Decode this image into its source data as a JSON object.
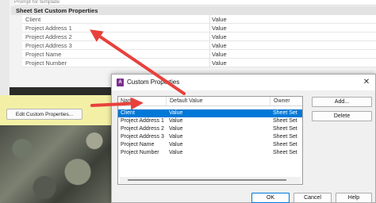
{
  "background_panel": {
    "top_row_text": "Prompt for template",
    "section_title": "Sheet Set Custom Properties",
    "rows": [
      {
        "name": "Client",
        "value": "Value"
      },
      {
        "name": "Project Address 1",
        "value": "Value"
      },
      {
        "name": "Project Address 2",
        "value": "Value"
      },
      {
        "name": "Project Address 3",
        "value": "Value"
      },
      {
        "name": "Project Name",
        "value": "Value"
      },
      {
        "name": "Project Number",
        "value": "Value"
      }
    ],
    "edit_button_label": "Edit Custom Properties..."
  },
  "dialog": {
    "title": "Custom Properties",
    "icon": "app-icon",
    "columns": [
      "Name",
      "Default Value",
      "Owner"
    ],
    "rows": [
      {
        "name": "Client",
        "value": "Value",
        "owner": "Sheet Set",
        "selected": true
      },
      {
        "name": "Project Address 1",
        "value": "Value",
        "owner": "Sheet Set"
      },
      {
        "name": "Project Address 2",
        "value": "Value",
        "owner": "Sheet Set"
      },
      {
        "name": "Project Address 3",
        "value": "Value",
        "owner": "Sheet Set"
      },
      {
        "name": "Project Name",
        "value": "Value",
        "owner": "Sheet Set"
      },
      {
        "name": "Project Number",
        "value": "Value",
        "owner": "Sheet Set"
      }
    ],
    "buttons": {
      "add": "Add...",
      "delete": "Delete",
      "ok": "OK",
      "cancel": "Cancel",
      "help": "Help"
    },
    "close_symbol": "✕"
  },
  "annotation_color": "#e8413c",
  "selection_color": "#0078d7"
}
